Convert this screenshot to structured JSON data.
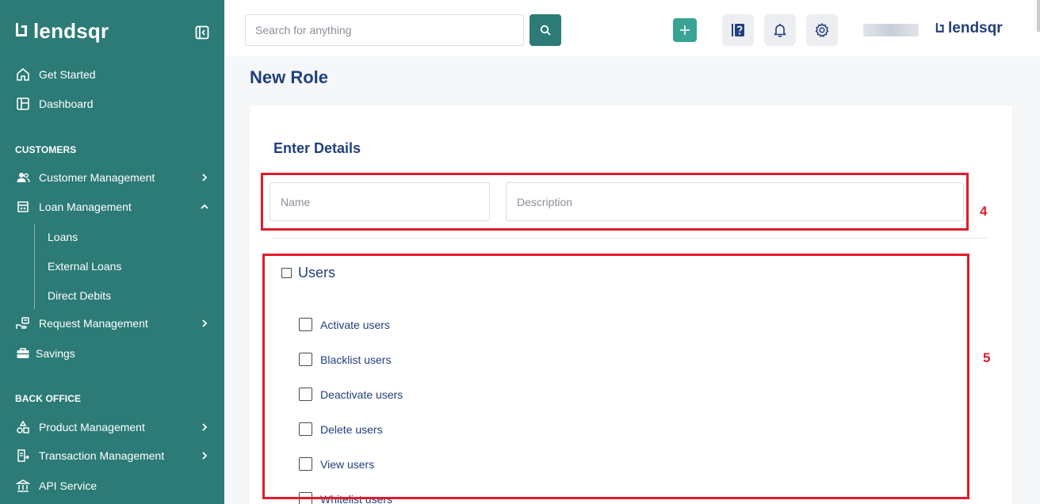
{
  "brand": {
    "name": "lendsqr"
  },
  "sidebar": {
    "top_items": [
      {
        "label": "Get Started",
        "icon": "home-icon"
      },
      {
        "label": "Dashboard",
        "icon": "dashboard-icon"
      }
    ],
    "sections": [
      {
        "title": "CUSTOMERS",
        "items": [
          {
            "label": "Customer Management",
            "icon": "users-icon",
            "expanded": false
          },
          {
            "label": "Loan Management",
            "icon": "loan-icon",
            "expanded": true,
            "children": [
              "Loans",
              "External Loans",
              "Direct Debits"
            ]
          },
          {
            "label": "Request Management",
            "icon": "request-icon",
            "expanded": false
          },
          {
            "label": "Savings",
            "icon": "briefcase-icon"
          }
        ]
      },
      {
        "title": "BACK OFFICE",
        "items": [
          {
            "label": "Product Management",
            "icon": "product-icon",
            "expanded": false
          },
          {
            "label": "Transaction Management",
            "icon": "transaction-icon",
            "expanded": false
          },
          {
            "label": "API Service",
            "icon": "bank-icon"
          }
        ]
      }
    ]
  },
  "topbar": {
    "search_placeholder": "Search for anything",
    "icons": [
      "search-icon",
      "plus-icon",
      "help-icon",
      "bell-icon",
      "gear-icon"
    ]
  },
  "page": {
    "title": "New Role",
    "card_title": "Enter Details",
    "name_placeholder": "Name",
    "description_placeholder": "Description",
    "permission_group": {
      "title": "Users",
      "permissions": [
        "Activate users",
        "Blacklist users",
        "Deactivate users",
        "Delete users",
        "View users",
        "Whitelist users"
      ]
    }
  },
  "annotations": [
    {
      "number": "4",
      "color": "#e01b2c"
    },
    {
      "number": "5",
      "color": "#e01b2c"
    }
  ],
  "colors": {
    "sidebar_bg": "#2c7b76",
    "primary_text": "#213f7d",
    "accent": "#39a394",
    "annotation_red": "#e01b2c"
  }
}
